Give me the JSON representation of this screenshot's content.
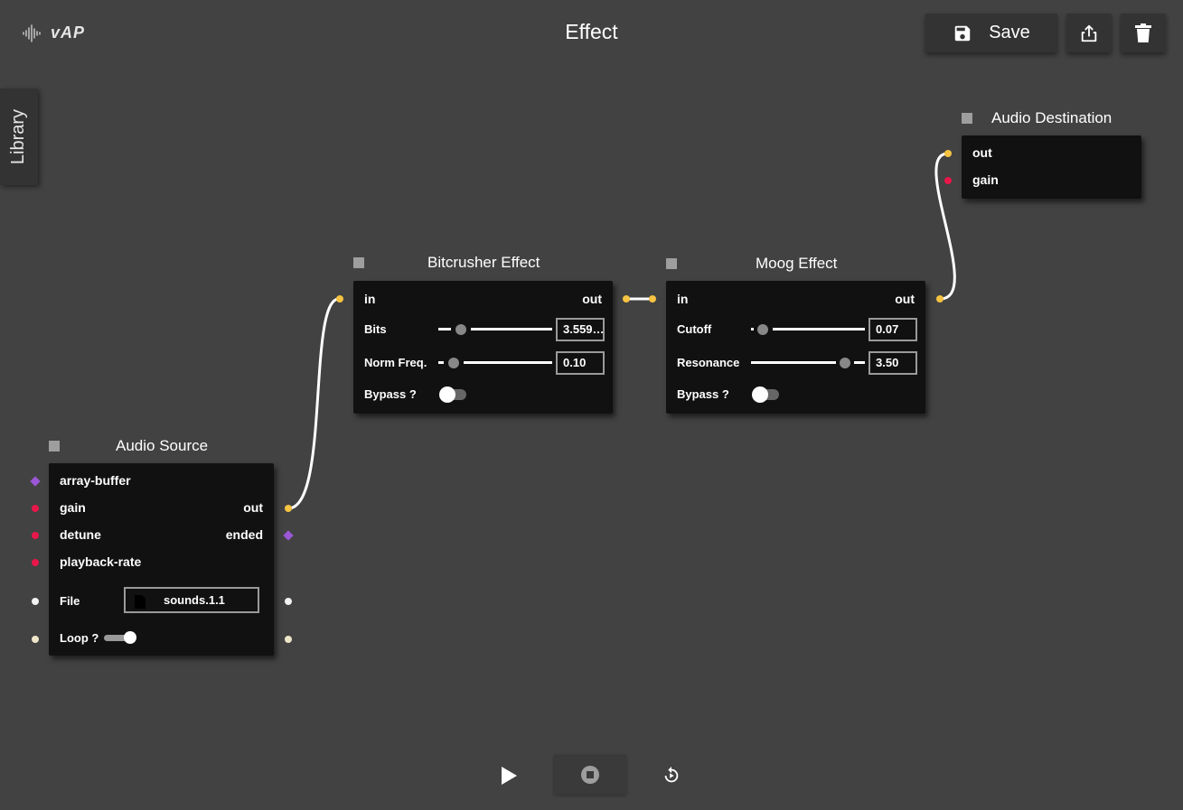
{
  "app": {
    "logo": "vAP",
    "title": "Effect"
  },
  "toolbar": {
    "save_label": "Save"
  },
  "sidebar": {
    "library_label": "Library"
  },
  "nodes": {
    "source": {
      "title": "Audio Source",
      "inputs": [
        "array-buffer",
        "gain",
        "detune",
        "playback-rate"
      ],
      "outputs": [
        "out",
        "ended"
      ],
      "file_label": "File",
      "file_value": "sounds.1.1",
      "loop_label": "Loop ?",
      "loop_on": true
    },
    "bitcrusher": {
      "title": "Bitcrusher Effect",
      "in_label": "in",
      "out_label": "out",
      "bits_label": "Bits",
      "bits_value": "3.559…",
      "freq_label": "Norm Freq.",
      "freq_value": "0.10",
      "bypass_label": "Bypass ?",
      "bypass_on": false
    },
    "moog": {
      "title": "Moog Effect",
      "in_label": "in",
      "out_label": "out",
      "cutoff_label": "Cutoff",
      "cutoff_value": "0.07",
      "resonance_label": "Resonance",
      "resonance_value": "3.50",
      "bypass_label": "Bypass ?",
      "bypass_on": false
    },
    "destination": {
      "title": "Audio Destination",
      "inputs": [
        "out",
        "gain"
      ]
    }
  },
  "colors": {
    "background": "#424242",
    "node_background": "#111111",
    "audio_port": "#f6c342",
    "param_port": "#e8174a",
    "event_port": "#9b57d6",
    "wire": "#ffffff"
  },
  "icons": [
    "waveform-icon",
    "save-icon",
    "share-icon",
    "trash-icon",
    "file-icon",
    "play-icon",
    "stop-icon",
    "replay-icon"
  ]
}
